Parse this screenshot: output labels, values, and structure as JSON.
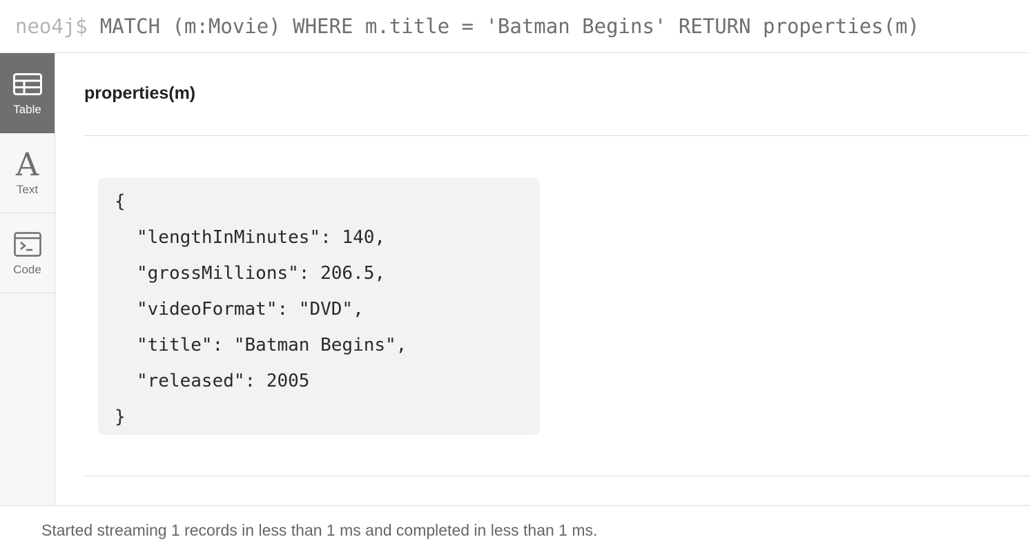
{
  "query": {
    "prompt": "neo4j$",
    "text": "MATCH (m:Movie) WHERE m.title = 'Batman Begins' RETURN properties(m)"
  },
  "sidebar": {
    "tabs": [
      {
        "label": "Table",
        "icon": "table-icon",
        "active": true
      },
      {
        "label": "Text",
        "icon": "text-icon",
        "glyph": "A",
        "active": false
      },
      {
        "label": "Code",
        "icon": "code-terminal-icon",
        "active": false
      }
    ]
  },
  "result": {
    "column_header": "properties(m)",
    "json_lines": [
      "{",
      "\"lengthInMinutes\": 140,",
      "\"grossMillions\": 206.5,",
      "\"videoFormat\": \"DVD\",",
      "\"title\": \"Batman Begins\",",
      "\"released\": 2005",
      "}"
    ]
  },
  "footer": {
    "status": "Started streaming 1 records in less than 1 ms and completed in less than 1 ms."
  },
  "colors": {
    "active_tab_bg": "#6f6f6f",
    "sidebar_bg": "#f6f7f9",
    "json_box_bg": "#f2f2f2",
    "prompt": "#b5b5b5",
    "query_text": "#6f6f6f"
  }
}
